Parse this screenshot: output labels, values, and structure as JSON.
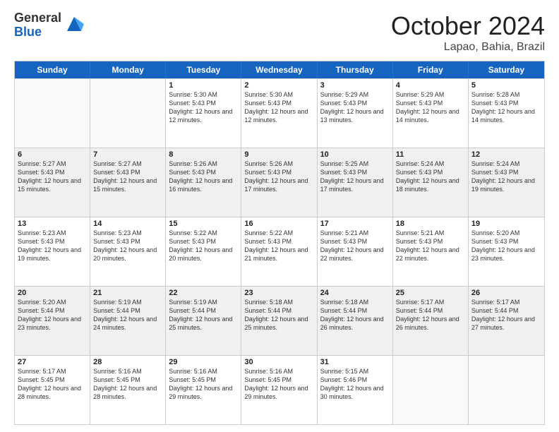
{
  "logo": {
    "general": "General",
    "blue": "Blue"
  },
  "title": "October 2024",
  "location": "Lapao, Bahia, Brazil",
  "days_of_week": [
    "Sunday",
    "Monday",
    "Tuesday",
    "Wednesday",
    "Thursday",
    "Friday",
    "Saturday"
  ],
  "weeks": [
    [
      {
        "day": "",
        "info": "",
        "empty": true
      },
      {
        "day": "",
        "info": "",
        "empty": true
      },
      {
        "day": "1",
        "info": "Sunrise: 5:30 AM\nSunset: 5:43 PM\nDaylight: 12 hours and 12 minutes.",
        "empty": false
      },
      {
        "day": "2",
        "info": "Sunrise: 5:30 AM\nSunset: 5:43 PM\nDaylight: 12 hours and 12 minutes.",
        "empty": false
      },
      {
        "day": "3",
        "info": "Sunrise: 5:29 AM\nSunset: 5:43 PM\nDaylight: 12 hours and 13 minutes.",
        "empty": false
      },
      {
        "day": "4",
        "info": "Sunrise: 5:29 AM\nSunset: 5:43 PM\nDaylight: 12 hours and 14 minutes.",
        "empty": false
      },
      {
        "day": "5",
        "info": "Sunrise: 5:28 AM\nSunset: 5:43 PM\nDaylight: 12 hours and 14 minutes.",
        "empty": false
      }
    ],
    [
      {
        "day": "6",
        "info": "Sunrise: 5:27 AM\nSunset: 5:43 PM\nDaylight: 12 hours and 15 minutes.",
        "empty": false
      },
      {
        "day": "7",
        "info": "Sunrise: 5:27 AM\nSunset: 5:43 PM\nDaylight: 12 hours and 15 minutes.",
        "empty": false
      },
      {
        "day": "8",
        "info": "Sunrise: 5:26 AM\nSunset: 5:43 PM\nDaylight: 12 hours and 16 minutes.",
        "empty": false
      },
      {
        "day": "9",
        "info": "Sunrise: 5:26 AM\nSunset: 5:43 PM\nDaylight: 12 hours and 17 minutes.",
        "empty": false
      },
      {
        "day": "10",
        "info": "Sunrise: 5:25 AM\nSunset: 5:43 PM\nDaylight: 12 hours and 17 minutes.",
        "empty": false
      },
      {
        "day": "11",
        "info": "Sunrise: 5:24 AM\nSunset: 5:43 PM\nDaylight: 12 hours and 18 minutes.",
        "empty": false
      },
      {
        "day": "12",
        "info": "Sunrise: 5:24 AM\nSunset: 5:43 PM\nDaylight: 12 hours and 19 minutes.",
        "empty": false
      }
    ],
    [
      {
        "day": "13",
        "info": "Sunrise: 5:23 AM\nSunset: 5:43 PM\nDaylight: 12 hours and 19 minutes.",
        "empty": false
      },
      {
        "day": "14",
        "info": "Sunrise: 5:23 AM\nSunset: 5:43 PM\nDaylight: 12 hours and 20 minutes.",
        "empty": false
      },
      {
        "day": "15",
        "info": "Sunrise: 5:22 AM\nSunset: 5:43 PM\nDaylight: 12 hours and 20 minutes.",
        "empty": false
      },
      {
        "day": "16",
        "info": "Sunrise: 5:22 AM\nSunset: 5:43 PM\nDaylight: 12 hours and 21 minutes.",
        "empty": false
      },
      {
        "day": "17",
        "info": "Sunrise: 5:21 AM\nSunset: 5:43 PM\nDaylight: 12 hours and 22 minutes.",
        "empty": false
      },
      {
        "day": "18",
        "info": "Sunrise: 5:21 AM\nSunset: 5:43 PM\nDaylight: 12 hours and 22 minutes.",
        "empty": false
      },
      {
        "day": "19",
        "info": "Sunrise: 5:20 AM\nSunset: 5:43 PM\nDaylight: 12 hours and 23 minutes.",
        "empty": false
      }
    ],
    [
      {
        "day": "20",
        "info": "Sunrise: 5:20 AM\nSunset: 5:44 PM\nDaylight: 12 hours and 23 minutes.",
        "empty": false
      },
      {
        "day": "21",
        "info": "Sunrise: 5:19 AM\nSunset: 5:44 PM\nDaylight: 12 hours and 24 minutes.",
        "empty": false
      },
      {
        "day": "22",
        "info": "Sunrise: 5:19 AM\nSunset: 5:44 PM\nDaylight: 12 hours and 25 minutes.",
        "empty": false
      },
      {
        "day": "23",
        "info": "Sunrise: 5:18 AM\nSunset: 5:44 PM\nDaylight: 12 hours and 25 minutes.",
        "empty": false
      },
      {
        "day": "24",
        "info": "Sunrise: 5:18 AM\nSunset: 5:44 PM\nDaylight: 12 hours and 26 minutes.",
        "empty": false
      },
      {
        "day": "25",
        "info": "Sunrise: 5:17 AM\nSunset: 5:44 PM\nDaylight: 12 hours and 26 minutes.",
        "empty": false
      },
      {
        "day": "26",
        "info": "Sunrise: 5:17 AM\nSunset: 5:44 PM\nDaylight: 12 hours and 27 minutes.",
        "empty": false
      }
    ],
    [
      {
        "day": "27",
        "info": "Sunrise: 5:17 AM\nSunset: 5:45 PM\nDaylight: 12 hours and 28 minutes.",
        "empty": false
      },
      {
        "day": "28",
        "info": "Sunrise: 5:16 AM\nSunset: 5:45 PM\nDaylight: 12 hours and 28 minutes.",
        "empty": false
      },
      {
        "day": "29",
        "info": "Sunrise: 5:16 AM\nSunset: 5:45 PM\nDaylight: 12 hours and 29 minutes.",
        "empty": false
      },
      {
        "day": "30",
        "info": "Sunrise: 5:16 AM\nSunset: 5:45 PM\nDaylight: 12 hours and 29 minutes.",
        "empty": false
      },
      {
        "day": "31",
        "info": "Sunrise: 5:15 AM\nSunset: 5:46 PM\nDaylight: 12 hours and 30 minutes.",
        "empty": false
      },
      {
        "day": "",
        "info": "",
        "empty": true
      },
      {
        "day": "",
        "info": "",
        "empty": true
      }
    ]
  ]
}
